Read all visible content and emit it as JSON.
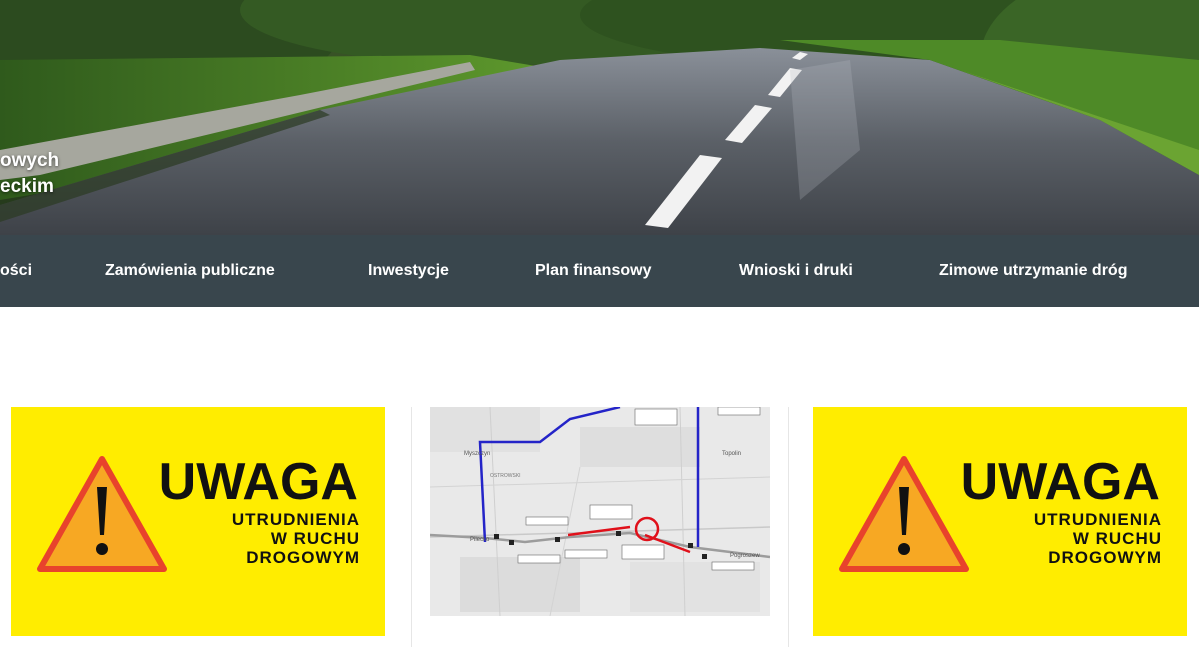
{
  "hero": {
    "title_lines": [
      "owych",
      "eckim"
    ]
  },
  "nav": {
    "items": [
      {
        "label": "ości"
      },
      {
        "label": "Zamówienia publiczne"
      },
      {
        "label": "Inwestycje"
      },
      {
        "label": "Plan finansowy"
      },
      {
        "label": "Wnioski i druki"
      },
      {
        "label": "Zimowe utrzymanie dróg"
      }
    ]
  },
  "cards": [
    {
      "sign": {
        "headline": "UWAGA",
        "line1": "UTRUDNIENIA",
        "line2": "W RUCHU",
        "line3": "DROGOWYM"
      }
    },
    {
      "map": {
        "places": [
          "Myszczyn",
          "Topolin",
          "Pilecko",
          "Pogroszew",
          "OSTROWSKI"
        ]
      }
    },
    {
      "sign": {
        "headline": "UWAGA",
        "line1": "UTRUDNIENIA",
        "line2": "W RUCHU",
        "line3": "DROGOWYM"
      }
    }
  ],
  "colors": {
    "nav_bg": "#39464d",
    "sign_yellow": "#ffed00",
    "warning_orange": "#f7a823",
    "warning_border": "#e8432c",
    "map_blue": "#2424c8",
    "map_red": "#e0101a"
  }
}
